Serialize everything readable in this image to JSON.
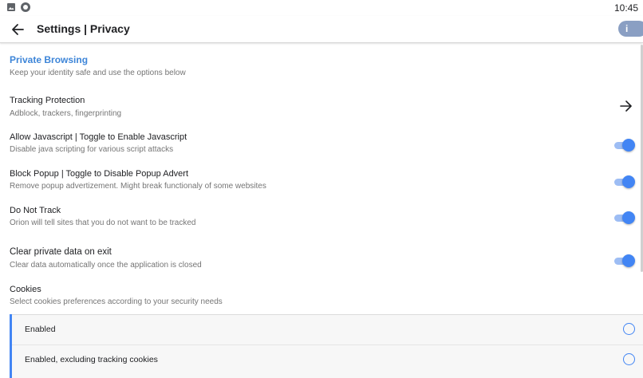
{
  "status_bar": {
    "time": "10:45",
    "icons": [
      "gallery-icon",
      "record-icon"
    ]
  },
  "toolbar": {
    "back_icon": "arrow-left-icon",
    "title": "Settings | Privacy",
    "info_label": "i"
  },
  "section": {
    "title": "Private Browsing",
    "subtitle": "Keep your identity safe and use the options below"
  },
  "settings": [
    {
      "title": "Tracking Protection",
      "subtitle": "Adblock, trackers, fingerprinting",
      "control": "arrow-right-icon"
    },
    {
      "title": "Allow Javascript | Toggle to Enable Javascript",
      "subtitle": "Disable java scripting for various script attacks",
      "control": "toggle",
      "enabled": true
    },
    {
      "title": "Block Popup | Toggle to Disable Popup Advert",
      "subtitle": "Remove popup advertizement. Might break functionaly of some websites",
      "control": "toggle",
      "enabled": true
    },
    {
      "title": "Do Not Track",
      "subtitle": "Orion will tell sites that you do not want to be tracked",
      "control": "toggle",
      "enabled": true
    },
    {
      "title": "Clear private data on exit",
      "subtitle": "Clear data automatically once the application is closed",
      "control": "toggle",
      "enabled": true
    },
    {
      "title": "Cookies",
      "subtitle": "Select cookies preferences according to your security needs"
    }
  ],
  "cookie_options": [
    {
      "label": "Enabled",
      "selected": false
    },
    {
      "label": "Enabled, excluding tracking cookies",
      "selected": false
    }
  ],
  "colors": {
    "accent": "#4285f4",
    "section_title": "#3d85d8",
    "toggle_track": "#9dbdf4",
    "info_button": "#8a9fc3"
  }
}
